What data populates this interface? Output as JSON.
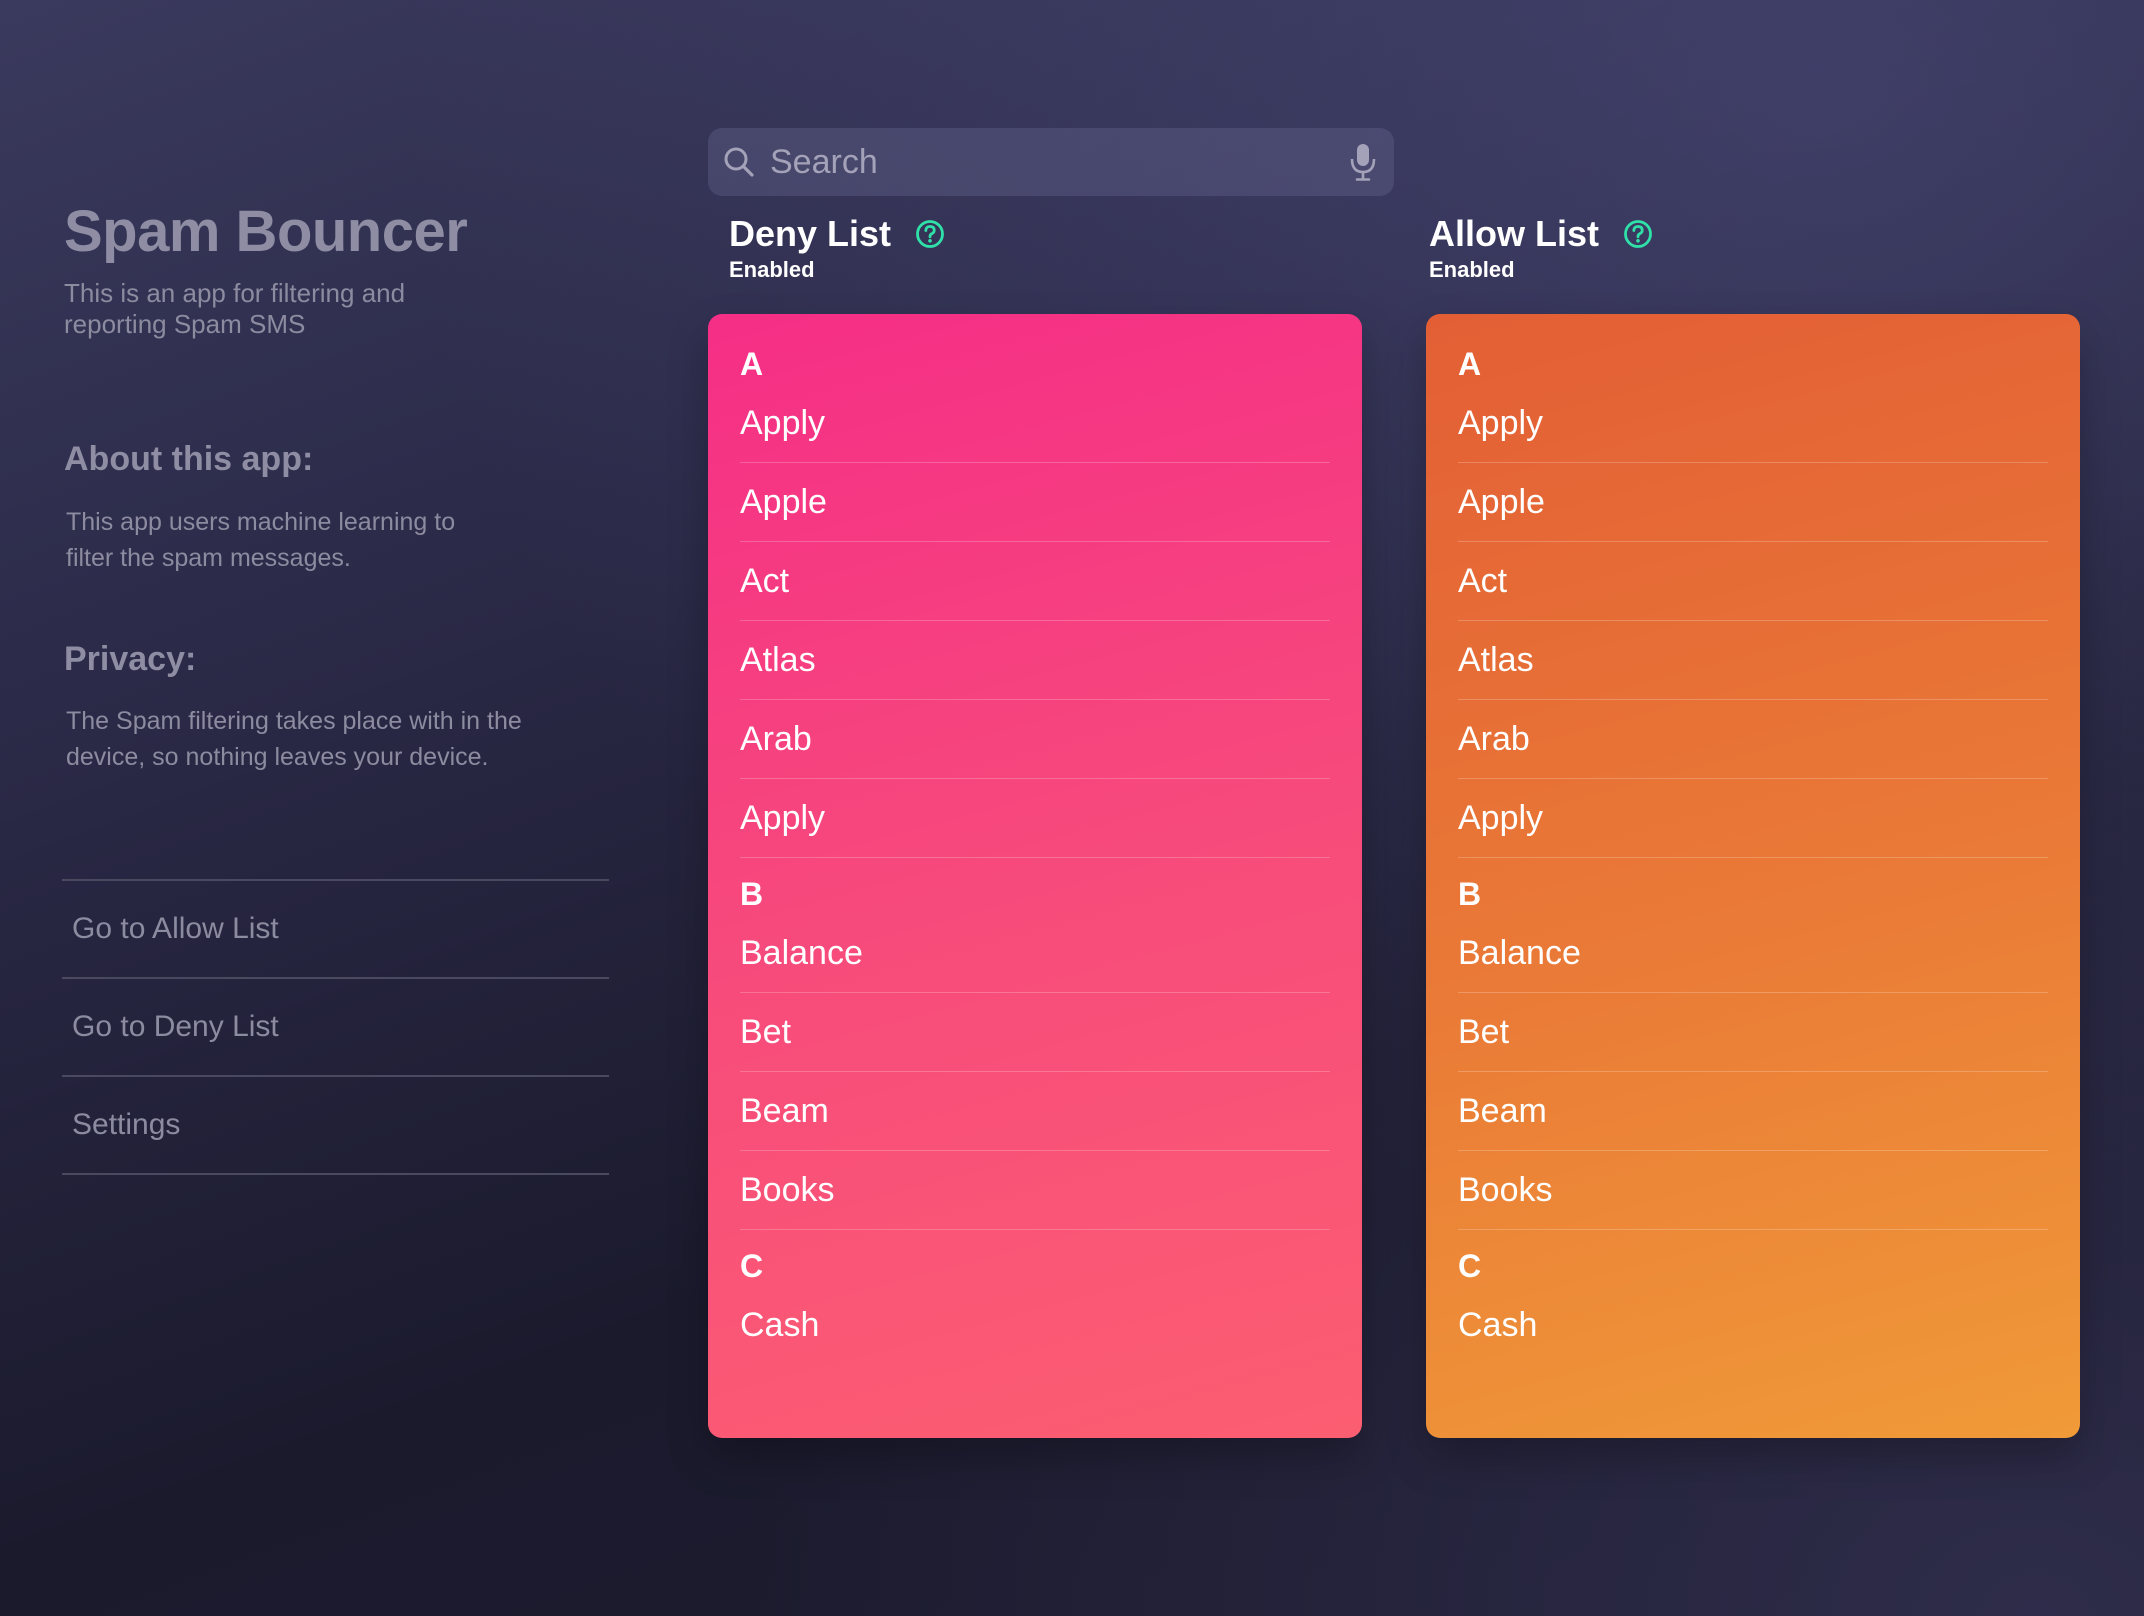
{
  "app": {
    "title": "Spam Bouncer",
    "subtitle": "This is an app for filtering and reporting Spam SMS"
  },
  "about": {
    "heading": "About this app:",
    "text": "This app users machine learning to filter the spam messages."
  },
  "privacy": {
    "heading": "Privacy:",
    "text": "The Spam filtering takes place with in the device, so nothing leaves your device."
  },
  "nav": {
    "items": [
      {
        "label": "Go to Allow List"
      },
      {
        "label": "Go to Deny List"
      },
      {
        "label": "Settings"
      }
    ]
  },
  "search": {
    "placeholder": "Search",
    "icon": "magnifying-glass-icon",
    "mic_icon": "microphone-icon"
  },
  "deny_list": {
    "title": "Deny List",
    "status": "Enabled",
    "help_icon": "question-circle-icon",
    "sections": [
      {
        "letter": "A",
        "items": [
          "Apply",
          "Apple",
          "Act",
          "Atlas",
          "Arab",
          "Apply"
        ]
      },
      {
        "letter": "B",
        "items": [
          "Balance",
          "Bet",
          "Beam",
          "Books"
        ]
      },
      {
        "letter": "C",
        "items": [
          "Cash"
        ]
      }
    ]
  },
  "allow_list": {
    "title": "Allow List",
    "status": "Enabled",
    "help_icon": "question-circle-icon",
    "sections": [
      {
        "letter": "A",
        "items": [
          "Apply",
          "Apple",
          "Act",
          "Atlas",
          "Arab",
          "Apply"
        ]
      },
      {
        "letter": "B",
        "items": [
          "Balance",
          "Bet",
          "Beam",
          "Books"
        ]
      },
      {
        "letter": "C",
        "items": [
          "Cash"
        ]
      }
    ]
  },
  "colors": {
    "deny_card_start": "#f52e86",
    "deny_card_end": "#fc5e71",
    "allow_card_start": "#e35e35",
    "allow_card_end": "#f09a38",
    "help_icon": "#2fe0a8",
    "sidebar_text": "#8c8ba0"
  }
}
